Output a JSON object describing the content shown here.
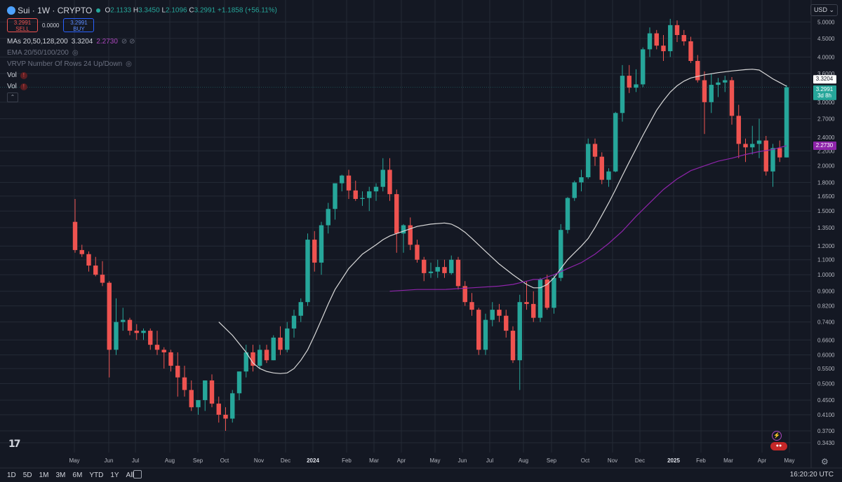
{
  "header": {
    "title": "Sui · 1W · CRYPTO",
    "open_label": "O",
    "open": "2.1133",
    "high_label": "H",
    "high": "3.3450",
    "low_label": "L",
    "low": "2.1096",
    "close_label": "C",
    "close": "3.2991",
    "change": "+1.1858 (+56.11%)",
    "sell_price": "3.2991",
    "sell_label": "SELL",
    "spread": "0.0000",
    "buy_price": "3.2991",
    "buy_label": "BUY"
  },
  "indicators": {
    "mas": "MAs 20,50,128,200",
    "mas_val1": "3.3204",
    "mas_val2": "2.2730",
    "ema": "EMA 20/50/100/200",
    "vrvp": "VRVP Number Of Rows 24 Up/Down",
    "vol1": "Vol",
    "vol2": "Vol"
  },
  "currency": "USD",
  "price_labels": {
    "ma1": "3.3204",
    "last": "3.2991",
    "countdown": "3d 8h",
    "ma2": "2.2730"
  },
  "bottom": {
    "timeframes": [
      "1D",
      "5D",
      "1M",
      "3M",
      "6M",
      "YTD",
      "1Y",
      "All"
    ],
    "clock": "16:20:20 UTC"
  },
  "colors": {
    "up": "#26a69a",
    "down": "#ef5350",
    "ma_white": "#d8d8d8",
    "ma_purple": "#8e24aa",
    "grid": "#242a36",
    "bg": "#141823"
  },
  "chart_data": {
    "type": "candlestick",
    "y_scale": "log",
    "y_ticks": [
      "5.0000",
      "4.5000",
      "4.0000",
      "3.6000",
      "3.0000",
      "2.7000",
      "2.4000",
      "2.2000",
      "2.0000",
      "1.8000",
      "1.6500",
      "1.5000",
      "1.3500",
      "1.2000",
      "1.1000",
      "1.0000",
      "0.9000",
      "0.8200",
      "0.7400",
      "0.6600",
      "0.6000",
      "0.5500",
      "0.5000",
      "0.4500",
      "0.4100",
      "0.3700",
      "0.3430"
    ],
    "x_labels": [
      "May",
      "Jun",
      "Jul",
      "Aug",
      "Sep",
      "Oct",
      "Nov",
      "Dec",
      "2024",
      "Feb",
      "Mar",
      "Apr",
      "May",
      "Jun",
      "Jul",
      "Aug",
      "Sep",
      "Oct",
      "Nov",
      "Dec",
      "2025",
      "Feb",
      "Mar",
      "Apr",
      "May"
    ],
    "x_label_bold": [
      "2024",
      "2025"
    ],
    "candles": [
      [
        1.4,
        1.62,
        1.15,
        1.17
      ],
      [
        1.17,
        1.21,
        1.12,
        1.14
      ],
      [
        1.14,
        1.16,
        1.02,
        1.06
      ],
      [
        1.06,
        1.12,
        0.99,
        1.0
      ],
      [
        1.0,
        1.09,
        0.93,
        0.95
      ],
      [
        0.95,
        0.96,
        0.52,
        0.62
      ],
      [
        0.62,
        0.86,
        0.6,
        0.74
      ],
      [
        0.74,
        0.81,
        0.7,
        0.75
      ],
      [
        0.75,
        0.76,
        0.68,
        0.7
      ],
      [
        0.7,
        0.73,
        0.66,
        0.69
      ],
      [
        0.69,
        0.71,
        0.66,
        0.7
      ],
      [
        0.7,
        0.71,
        0.62,
        0.64
      ],
      [
        0.64,
        0.7,
        0.6,
        0.62
      ],
      [
        0.62,
        0.63,
        0.55,
        0.61
      ],
      [
        0.61,
        0.62,
        0.54,
        0.56
      ],
      [
        0.56,
        0.61,
        0.46,
        0.52
      ],
      [
        0.52,
        0.56,
        0.46,
        0.48
      ],
      [
        0.48,
        0.51,
        0.42,
        0.43
      ],
      [
        0.43,
        0.45,
        0.41,
        0.45
      ],
      [
        0.45,
        0.51,
        0.42,
        0.51
      ],
      [
        0.51,
        0.53,
        0.43,
        0.44
      ],
      [
        0.44,
        0.46,
        0.39,
        0.41
      ],
      [
        0.41,
        0.43,
        0.37,
        0.4
      ],
      [
        0.4,
        0.48,
        0.39,
        0.47
      ],
      [
        0.47,
        0.54,
        0.45,
        0.54
      ],
      [
        0.54,
        0.64,
        0.52,
        0.61
      ],
      [
        0.61,
        0.64,
        0.54,
        0.56
      ],
      [
        0.56,
        0.64,
        0.55,
        0.62
      ],
      [
        0.62,
        0.64,
        0.57,
        0.58
      ],
      [
        0.58,
        0.68,
        0.58,
        0.67
      ],
      [
        0.67,
        0.72,
        0.6,
        0.62
      ],
      [
        0.62,
        0.74,
        0.61,
        0.71
      ],
      [
        0.71,
        0.8,
        0.67,
        0.77
      ],
      [
        0.77,
        0.86,
        0.74,
        0.84
      ],
      [
        0.84,
        1.3,
        0.82,
        1.25
      ],
      [
        1.25,
        1.32,
        1.02,
        1.08
      ],
      [
        1.08,
        1.4,
        1.0,
        1.37
      ],
      [
        1.37,
        1.58,
        1.3,
        1.52
      ],
      [
        1.52,
        1.78,
        1.42,
        1.79
      ],
      [
        1.79,
        1.89,
        1.7,
        1.88
      ],
      [
        1.88,
        1.95,
        1.62,
        1.71
      ],
      [
        1.71,
        1.82,
        1.6,
        1.62
      ],
      [
        1.62,
        1.7,
        1.55,
        1.63
      ],
      [
        1.63,
        1.75,
        1.5,
        1.7
      ],
      [
        1.7,
        1.79,
        1.6,
        1.75
      ],
      [
        1.75,
        2.1,
        1.7,
        1.95
      ],
      [
        1.95,
        2.1,
        1.6,
        1.67
      ],
      [
        1.67,
        1.72,
        1.15,
        1.3
      ],
      [
        1.3,
        1.38,
        1.15,
        1.37
      ],
      [
        1.37,
        1.44,
        1.17,
        1.21
      ],
      [
        1.21,
        1.25,
        1.08,
        1.1
      ],
      [
        1.1,
        1.12,
        0.96,
        1.01
      ],
      [
        1.01,
        1.08,
        0.98,
        1.02
      ],
      [
        1.02,
        1.1,
        0.98,
        1.05
      ],
      [
        1.05,
        1.1,
        0.98,
        1.01
      ],
      [
        1.01,
        1.13,
        1.0,
        1.1
      ],
      [
        1.1,
        1.12,
        0.91,
        0.93
      ],
      [
        0.93,
        0.96,
        0.82,
        0.84
      ],
      [
        0.84,
        0.89,
        0.77,
        0.8
      ],
      [
        0.8,
        0.81,
        0.6,
        0.62
      ],
      [
        0.62,
        0.78,
        0.6,
        0.75
      ],
      [
        0.75,
        0.84,
        0.72,
        0.8
      ],
      [
        0.8,
        0.83,
        0.74,
        0.77
      ],
      [
        0.77,
        0.8,
        0.67,
        0.7
      ],
      [
        0.7,
        0.72,
        0.57,
        0.58
      ],
      [
        0.58,
        0.88,
        0.48,
        0.84
      ],
      [
        0.84,
        0.96,
        0.8,
        0.83
      ],
      [
        0.83,
        0.9,
        0.74,
        0.76
      ],
      [
        0.76,
        0.98,
        0.74,
        0.97
      ],
      [
        0.97,
        1.0,
        0.8,
        0.81
      ],
      [
        0.81,
        1.0,
        0.78,
        0.98
      ],
      [
        0.98,
        1.38,
        0.96,
        1.33
      ],
      [
        1.33,
        1.64,
        1.3,
        1.63
      ],
      [
        1.63,
        1.82,
        1.6,
        1.8
      ],
      [
        1.8,
        1.95,
        1.7,
        1.86
      ],
      [
        1.86,
        2.38,
        1.84,
        2.3
      ],
      [
        2.3,
        2.38,
        2.0,
        2.12
      ],
      [
        2.12,
        2.18,
        1.78,
        1.83
      ],
      [
        1.83,
        1.97,
        1.75,
        1.93
      ],
      [
        1.93,
        2.82,
        1.92,
        2.8
      ],
      [
        2.8,
        3.8,
        2.65,
        3.55
      ],
      [
        3.55,
        3.8,
        3.18,
        3.29
      ],
      [
        3.29,
        3.7,
        3.2,
        3.36
      ],
      [
        3.36,
        4.25,
        3.3,
        4.2
      ],
      [
        4.2,
        4.83,
        4.0,
        4.65
      ],
      [
        4.65,
        4.75,
        4.2,
        4.3
      ],
      [
        4.3,
        4.6,
        3.9,
        4.15
      ],
      [
        4.15,
        5.1,
        4.0,
        4.9
      ],
      [
        4.9,
        5.05,
        4.4,
        4.6
      ],
      [
        4.6,
        4.75,
        4.3,
        4.42
      ],
      [
        4.42,
        4.55,
        3.85,
        3.9
      ],
      [
        3.9,
        4.05,
        3.4,
        3.45
      ],
      [
        3.45,
        3.65,
        2.45,
        3.0
      ],
      [
        3.0,
        3.6,
        2.8,
        3.35
      ],
      [
        3.35,
        3.5,
        3.1,
        3.4
      ],
      [
        3.4,
        3.55,
        3.2,
        3.45
      ],
      [
        3.45,
        3.52,
        2.6,
        2.75
      ],
      [
        2.75,
        2.95,
        2.1,
        2.3
      ],
      [
        2.3,
        2.38,
        2.05,
        2.25
      ],
      [
        2.25,
        2.58,
        2.15,
        2.3
      ],
      [
        2.3,
        2.7,
        2.1,
        2.35
      ],
      [
        2.35,
        2.42,
        1.88,
        1.93
      ],
      [
        1.93,
        2.3,
        1.75,
        2.24
      ],
      [
        2.24,
        2.35,
        2.05,
        2.11
      ],
      [
        2.11,
        3.345,
        2.1096,
        3.2991
      ]
    ],
    "ma_white": [
      [
        21,
        0.74
      ],
      [
        23,
        0.68
      ],
      [
        25,
        0.61
      ],
      [
        26,
        0.57
      ],
      [
        27,
        0.55
      ],
      [
        28,
        0.54
      ],
      [
        29,
        0.535
      ],
      [
        30,
        0.533
      ],
      [
        31,
        0.535
      ],
      [
        32,
        0.55
      ],
      [
        33,
        0.58
      ],
      [
        34,
        0.62
      ],
      [
        35,
        0.68
      ],
      [
        36,
        0.75
      ],
      [
        37,
        0.83
      ],
      [
        38,
        0.91
      ],
      [
        40,
        1.04
      ],
      [
        42,
        1.14
      ],
      [
        44,
        1.21
      ],
      [
        45,
        1.25
      ],
      [
        46,
        1.28
      ],
      [
        47,
        1.3
      ],
      [
        48,
        1.32
      ],
      [
        50,
        1.36
      ],
      [
        52,
        1.38
      ],
      [
        54,
        1.39
      ],
      [
        55,
        1.38
      ],
      [
        56,
        1.35
      ],
      [
        57,
        1.31
      ],
      [
        58,
        1.26
      ],
      [
        60,
        1.16
      ],
      [
        62,
        1.07
      ],
      [
        64,
        1.0
      ],
      [
        66,
        0.94
      ],
      [
        67,
        0.92
      ],
      [
        68,
        0.92
      ],
      [
        69,
        0.94
      ],
      [
        70,
        0.98
      ],
      [
        71,
        1.04
      ],
      [
        72,
        1.1
      ],
      [
        73,
        1.15
      ],
      [
        74,
        1.2
      ],
      [
        75,
        1.26
      ],
      [
        76,
        1.35
      ],
      [
        77,
        1.46
      ],
      [
        78,
        1.58
      ],
      [
        79,
        1.72
      ],
      [
        80,
        1.88
      ],
      [
        81,
        2.05
      ],
      [
        82,
        2.23
      ],
      [
        83,
        2.43
      ],
      [
        84,
        2.63
      ],
      [
        85,
        2.85
      ],
      [
        86,
        3.03
      ],
      [
        87,
        3.2
      ],
      [
        88,
        3.33
      ],
      [
        89,
        3.43
      ],
      [
        90,
        3.5
      ],
      [
        92,
        3.57
      ],
      [
        94,
        3.62
      ],
      [
        96,
        3.66
      ],
      [
        98,
        3.69
      ],
      [
        99,
        3.7
      ],
      [
        100,
        3.68
      ],
      [
        101,
        3.58
      ],
      [
        102,
        3.48
      ],
      [
        103,
        3.4
      ],
      [
        104,
        3.32
      ]
    ],
    "ma_purple": [
      [
        46,
        0.9
      ],
      [
        50,
        0.91
      ],
      [
        54,
        0.91
      ],
      [
        58,
        0.92
      ],
      [
        62,
        0.93
      ],
      [
        64,
        0.94
      ],
      [
        66,
        0.96
      ],
      [
        67,
        0.97
      ],
      [
        68,
        0.97
      ],
      [
        70,
        1.0
      ],
      [
        72,
        1.04
      ],
      [
        74,
        1.08
      ],
      [
        76,
        1.14
      ],
      [
        78,
        1.22
      ],
      [
        80,
        1.32
      ],
      [
        82,
        1.45
      ],
      [
        84,
        1.58
      ],
      [
        86,
        1.72
      ],
      [
        88,
        1.84
      ],
      [
        90,
        1.94
      ],
      [
        92,
        2.0
      ],
      [
        94,
        2.06
      ],
      [
        96,
        2.1
      ],
      [
        98,
        2.15
      ],
      [
        100,
        2.19
      ],
      [
        102,
        2.22
      ],
      [
        104,
        2.273
      ]
    ]
  }
}
